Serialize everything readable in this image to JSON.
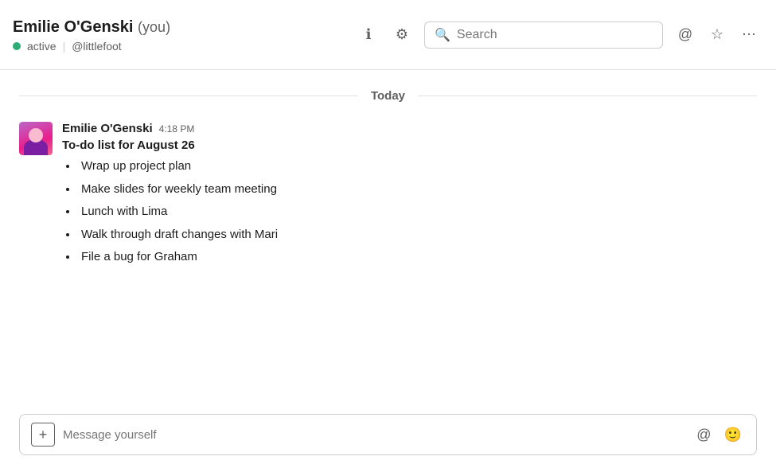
{
  "header": {
    "name": "Emilie O'Genski",
    "you_label": "(you)",
    "status_text": "active",
    "handle": "@littlefoot",
    "search_placeholder": "Search"
  },
  "toolbar": {
    "info_icon": "ℹ",
    "settings_icon": "⚙",
    "at_icon": "@",
    "star_icon": "☆",
    "more_icon": "⋯"
  },
  "date_divider": {
    "label": "Today"
  },
  "message": {
    "author": "Emilie O'Genski",
    "time": "4:18 PM",
    "title": "To-do list for August 26",
    "items": [
      "Wrap up project plan",
      "Make slides for weekly team meeting",
      "Lunch with Lima",
      "Walk through draft changes with Mari",
      "File a bug for Graham"
    ]
  },
  "input": {
    "placeholder": "Message yourself",
    "add_icon": "+",
    "at_icon": "@",
    "emoji_icon": "🙂"
  }
}
